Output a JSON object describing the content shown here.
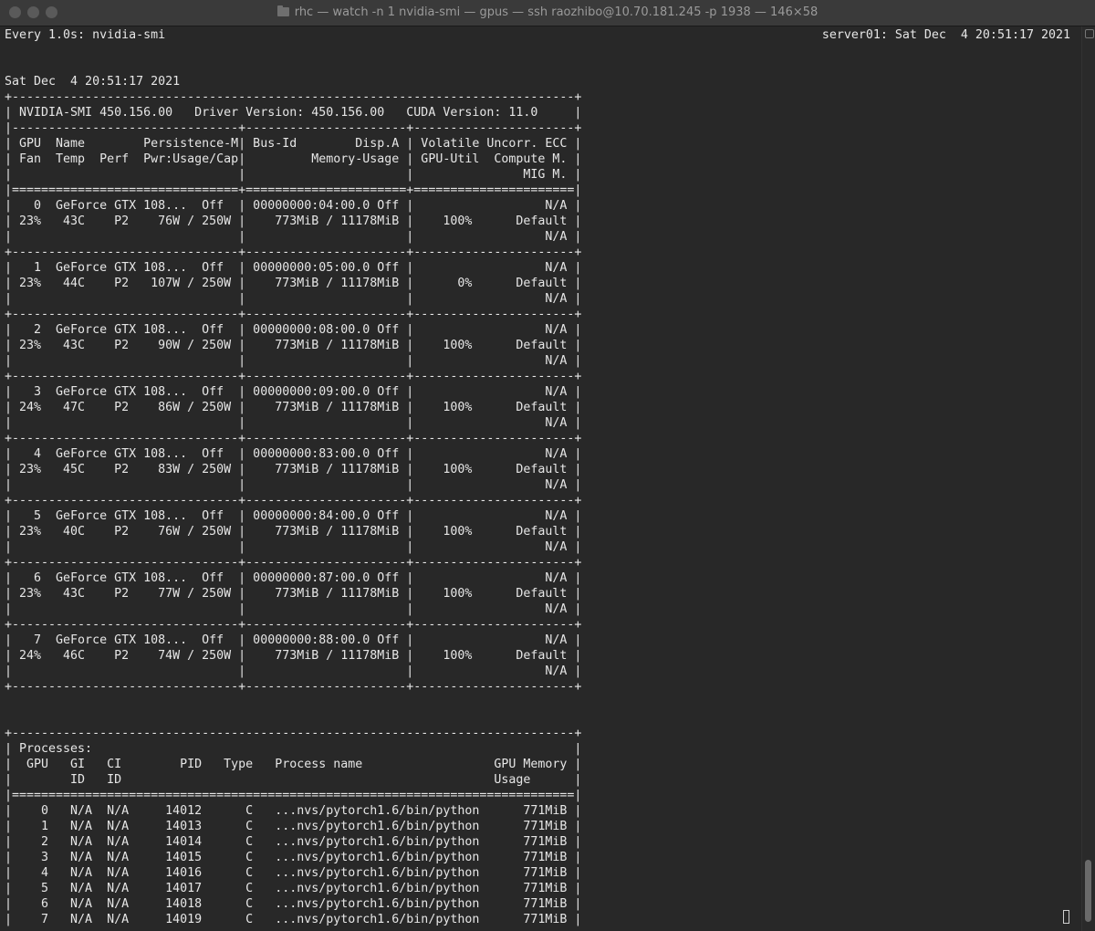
{
  "window": {
    "title": "rhc — watch -n 1 nvidia-smi — gpus — ssh raozhibo@10.70.181.245 -p 1938 — 146×58"
  },
  "terminal": {
    "header_left": "Every 1.0s: nvidia-smi",
    "header_right": "server01: Sat Dec  4 20:51:17 2021",
    "lines": [
      "",
      "",
      "Sat Dec  4 20:51:17 2021",
      "+-----------------------------------------------------------------------------+",
      "| NVIDIA-SMI 450.156.00   Driver Version: 450.156.00   CUDA Version: 11.0     |",
      "|-------------------------------+----------------------+----------------------+",
      "| GPU  Name        Persistence-M| Bus-Id        Disp.A | Volatile Uncorr. ECC |",
      "| Fan  Temp  Perf  Pwr:Usage/Cap|         Memory-Usage | GPU-Util  Compute M. |",
      "|                               |                      |               MIG M. |",
      "|===============================+======================+======================|",
      "|   0  GeForce GTX 108...  Off  | 00000000:04:00.0 Off |                  N/A |",
      "| 23%   43C    P2    76W / 250W |    773MiB / 11178MiB |    100%      Default |",
      "|                               |                      |                  N/A |",
      "+-------------------------------+----------------------+----------------------+",
      "|   1  GeForce GTX 108...  Off  | 00000000:05:00.0 Off |                  N/A |",
      "| 23%   44C    P2   107W / 250W |    773MiB / 11178MiB |      0%      Default |",
      "|                               |                      |                  N/A |",
      "+-------------------------------+----------------------+----------------------+",
      "|   2  GeForce GTX 108...  Off  | 00000000:08:00.0 Off |                  N/A |",
      "| 23%   43C    P2    90W / 250W |    773MiB / 11178MiB |    100%      Default |",
      "|                               |                      |                  N/A |",
      "+-------------------------------+----------------------+----------------------+",
      "|   3  GeForce GTX 108...  Off  | 00000000:09:00.0 Off |                  N/A |",
      "| 24%   47C    P2    86W / 250W |    773MiB / 11178MiB |    100%      Default |",
      "|                               |                      |                  N/A |",
      "+-------------------------------+----------------------+----------------------+",
      "|   4  GeForce GTX 108...  Off  | 00000000:83:00.0 Off |                  N/A |",
      "| 23%   45C    P2    83W / 250W |    773MiB / 11178MiB |    100%      Default |",
      "|                               |                      |                  N/A |",
      "+-------------------------------+----------------------+----------------------+",
      "|   5  GeForce GTX 108...  Off  | 00000000:84:00.0 Off |                  N/A |",
      "| 23%   40C    P2    76W / 250W |    773MiB / 11178MiB |    100%      Default |",
      "|                               |                      |                  N/A |",
      "+-------------------------------+----------------------+----------------------+",
      "|   6  GeForce GTX 108...  Off  | 00000000:87:00.0 Off |                  N/A |",
      "| 23%   43C    P2    77W / 250W |    773MiB / 11178MiB |    100%      Default |",
      "|                               |                      |                  N/A |",
      "+-------------------------------+----------------------+----------------------+",
      "|   7  GeForce GTX 108...  Off  | 00000000:88:00.0 Off |                  N/A |",
      "| 24%   46C    P2    74W / 250W |    773MiB / 11178MiB |    100%      Default |",
      "|                               |                      |                  N/A |",
      "+-------------------------------+----------------------+----------------------+",
      "",
      "",
      "+-----------------------------------------------------------------------------+",
      "| Processes:                                                                  |",
      "|  GPU   GI   CI        PID   Type   Process name                  GPU Memory |",
      "|        ID   ID                                                   Usage      |",
      "|=============================================================================|",
      "|    0   N/A  N/A     14012      C   ...nvs/pytorch1.6/bin/python      771MiB |",
      "|    1   N/A  N/A     14013      C   ...nvs/pytorch1.6/bin/python      771MiB |",
      "|    2   N/A  N/A     14014      C   ...nvs/pytorch1.6/bin/python      771MiB |",
      "|    3   N/A  N/A     14015      C   ...nvs/pytorch1.6/bin/python      771MiB |",
      "|    4   N/A  N/A     14016      C   ...nvs/pytorch1.6/bin/python      771MiB |",
      "|    5   N/A  N/A     14017      C   ...nvs/pytorch1.6/bin/python      771MiB |",
      "|    6   N/A  N/A     14018      C   ...nvs/pytorch1.6/bin/python      771MiB |",
      "|    7   N/A  N/A     14019      C   ...nvs/pytorch1.6/bin/python      771MiB |",
      "+-----------------------------------------------------------------------------+"
    ]
  }
}
